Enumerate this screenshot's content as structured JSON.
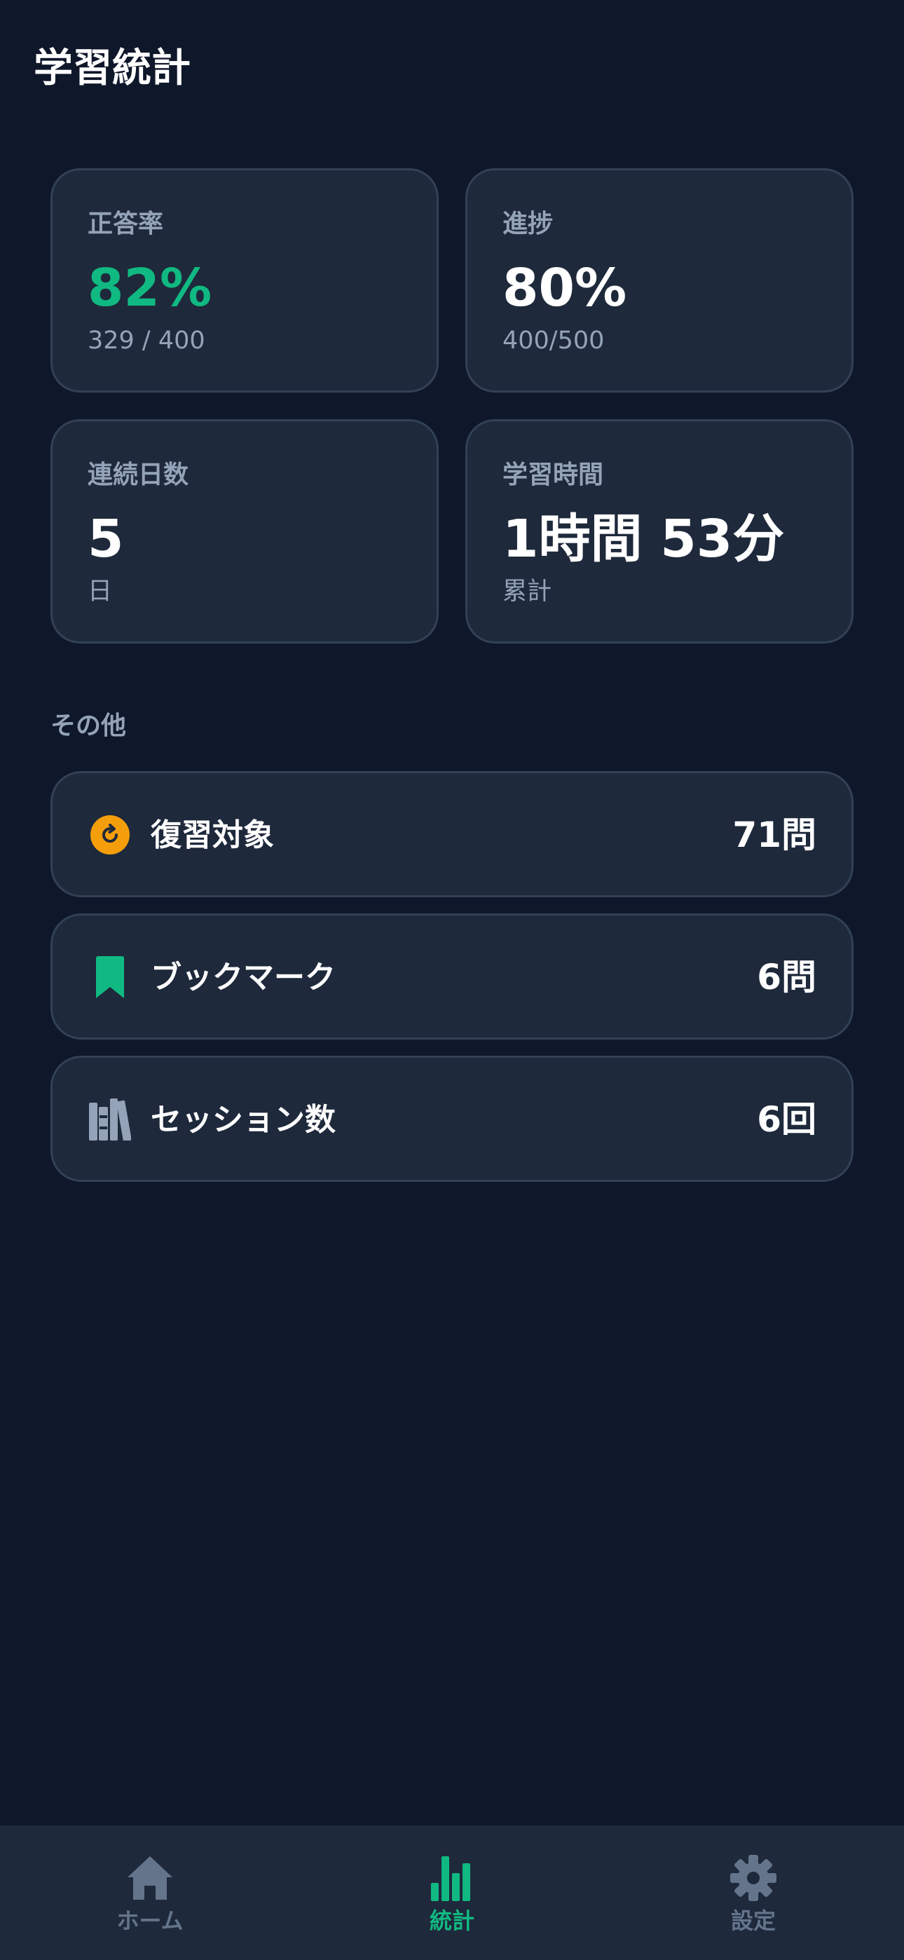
{
  "header": {
    "title": "学習統計"
  },
  "stats": [
    {
      "label": "正答率",
      "value": "82%",
      "sub": "329 / 400"
    },
    {
      "label": "進捗",
      "value": "80%",
      "sub": "400/500"
    },
    {
      "label": "連続日数",
      "value": "5",
      "sub": "日"
    },
    {
      "label": "学習時間",
      "value": "1時間 53分",
      "sub": "累計"
    }
  ],
  "other": {
    "section_label": "その他",
    "items": [
      {
        "label": "復習対象",
        "value": "71問",
        "icon": "review-icon"
      },
      {
        "label": "ブックマーク",
        "value": "6問",
        "icon": "bookmark-icon"
      },
      {
        "label": "セッション数",
        "value": "6回",
        "icon": "books-icon"
      }
    ]
  },
  "tabs": [
    {
      "label": "ホーム",
      "icon": "home-icon",
      "active": false
    },
    {
      "label": "統計",
      "icon": "bar-chart-icon",
      "active": true
    },
    {
      "label": "設定",
      "icon": "gear-icon",
      "active": false
    }
  ],
  "colors": {
    "background": "#0f172a",
    "card": "#1e293b",
    "border": "#334155",
    "accent": "#10b981",
    "muted": "#94a3b8",
    "review_icon": "#f59e0b"
  }
}
